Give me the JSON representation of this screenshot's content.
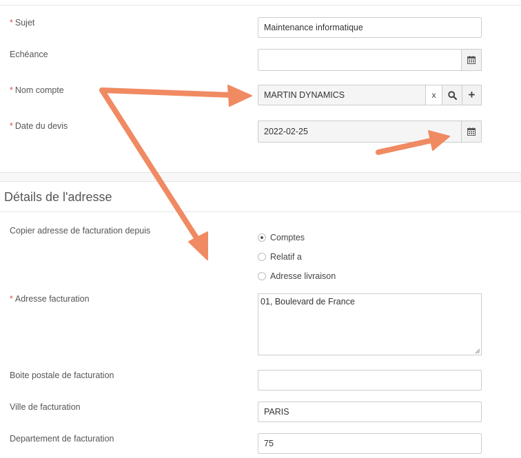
{
  "form": {
    "subject": {
      "label": "Sujet",
      "required": true,
      "value": "Maintenance informatique"
    },
    "due": {
      "label": "Echéance",
      "required": false,
      "value": "",
      "icon": "calendar-icon"
    },
    "account": {
      "label": "Nom compte",
      "required": true,
      "value": "MARTIN DYNAMICS",
      "clear_label": "x",
      "search_icon": "search-icon",
      "add_label": "+"
    },
    "quote_date": {
      "label": "Date du devis",
      "required": true,
      "value": "2022-02-25",
      "icon": "calendar-icon"
    }
  },
  "address_section": {
    "title": "Détails de l'adresse",
    "copy_from": {
      "label": "Copier adresse de facturation depuis",
      "options": [
        "Comptes",
        "Relatif a",
        "Adresse livraison"
      ],
      "selected": "Comptes"
    },
    "billing_address": {
      "label": "Adresse facturation",
      "required": true,
      "value": "01, Boulevard de France"
    },
    "billing_po_box": {
      "label": "Boite postale de facturation",
      "value": ""
    },
    "billing_city": {
      "label": "Ville de facturation",
      "value": "PARIS"
    },
    "billing_department": {
      "label": "Departement de facturation",
      "value": "75"
    }
  },
  "colors": {
    "required": "#d9534f",
    "annotation_arrow": "#f08a62",
    "border": "#cccccc"
  }
}
